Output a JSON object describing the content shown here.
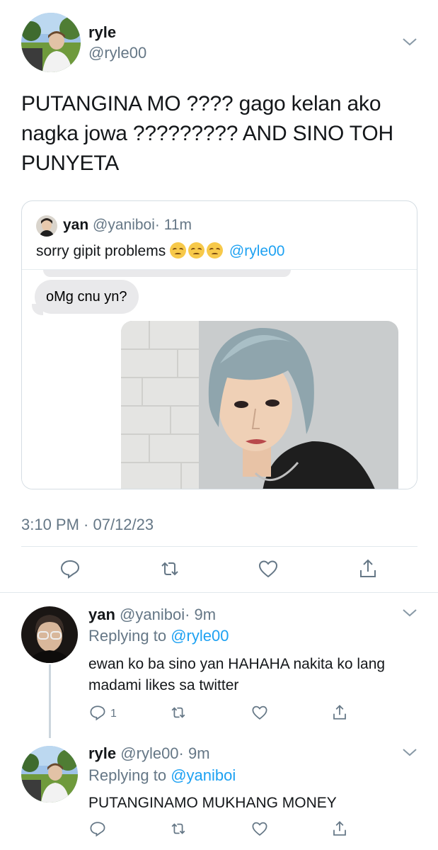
{
  "main_tweet": {
    "name": "ryle",
    "handle": "@ryle00",
    "text": "PUTANGINA MO ???? gago kelan ako nagka jowa ?????????  AND SINO TOH PUNYETA",
    "timestamp": "3:10 PM · 07/12/23",
    "quoted": {
      "name": "yan",
      "handle": "@yaniboi",
      "age": "· 11m",
      "text_before": "sorry gipit problems",
      "emojis": [
        "disappointed-face-emoji",
        "disappointed-face-emoji",
        "disappointed-face-emoji"
      ],
      "mention": "@ryle00",
      "message_bubble": "oMg cnu yn?"
    }
  },
  "replies": [
    {
      "name": "yan",
      "handle": "@yaniboi",
      "age": "· 9m",
      "replying_label": "Replying to",
      "replying_to": "@ryle00",
      "text": "ewan ko ba sino yan HAHAHA nakita ko lang madami likes sa twitter",
      "reply_count": "1"
    },
    {
      "name": "ryle",
      "handle": "@ryle00",
      "age": "· 9m",
      "replying_label": "Replying to",
      "replying_to": "@yaniboi",
      "text": "PUTANGINAMO MUKHANG MONEY"
    }
  ],
  "icons": [
    "chevron-down-icon",
    "reply-icon",
    "retweet-icon",
    "like-icon",
    "share-icon"
  ],
  "colors": {
    "link": "#1da1f2",
    "muted": "#657786",
    "text": "#14171a",
    "divider": "#e1e8ed"
  }
}
